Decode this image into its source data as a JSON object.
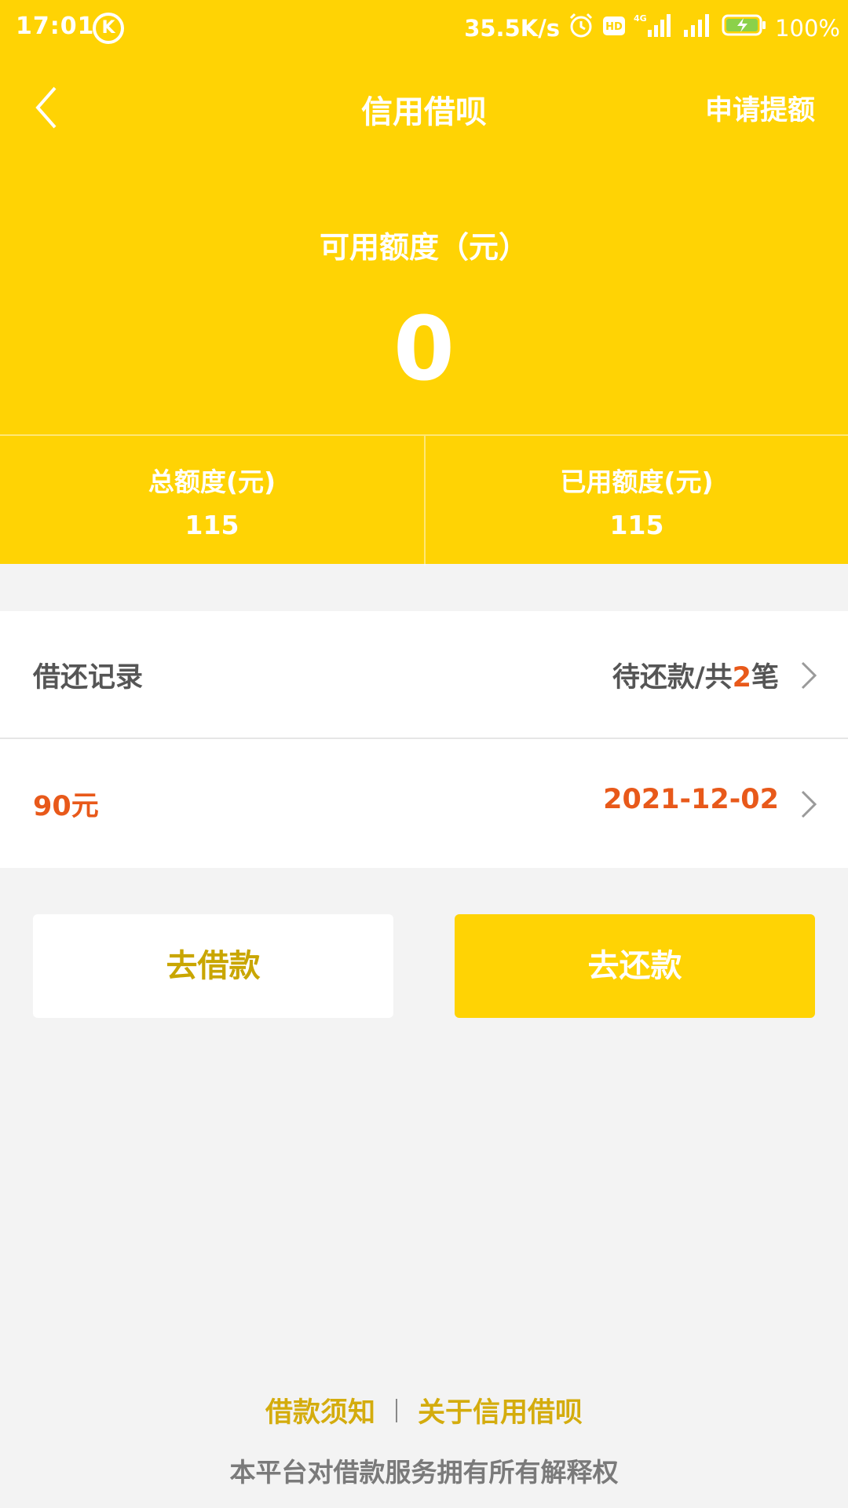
{
  "status_bar": {
    "time": "17:01",
    "k_badge": "K",
    "net_speed": "35.5K/s",
    "battery": "100%",
    "icons": [
      "alarm-icon",
      "hd-icon",
      "signal-4g-icon",
      "signal-icon",
      "battery-charging-icon"
    ]
  },
  "nav": {
    "title": "信用借呗",
    "action": "申请提额",
    "back_icon": "chevron-left-icon"
  },
  "credit": {
    "available_label": "可用额度（元）",
    "available_value": "0",
    "total_label": "总额度(元)",
    "total_value": "115",
    "used_label": "已用额度(元)",
    "used_value": "115"
  },
  "records": {
    "label": "借还记录",
    "status_prefix": "待还款/共",
    "count": "2",
    "status_suffix": "笔"
  },
  "pending": {
    "amount": "90元",
    "date": "2021-12-02"
  },
  "buttons": {
    "borrow": "去借款",
    "repay": "去还款"
  },
  "footer": {
    "link_notice": "借款须知",
    "link_about": "关于信用借呗",
    "note": "本平台对借款服务拥有所有解释权"
  },
  "colors": {
    "brand_yellow": "#ffd304",
    "accent_orange": "#e8591a",
    "link_gold": "#d4ac0d",
    "background": "#f3f3f3"
  }
}
